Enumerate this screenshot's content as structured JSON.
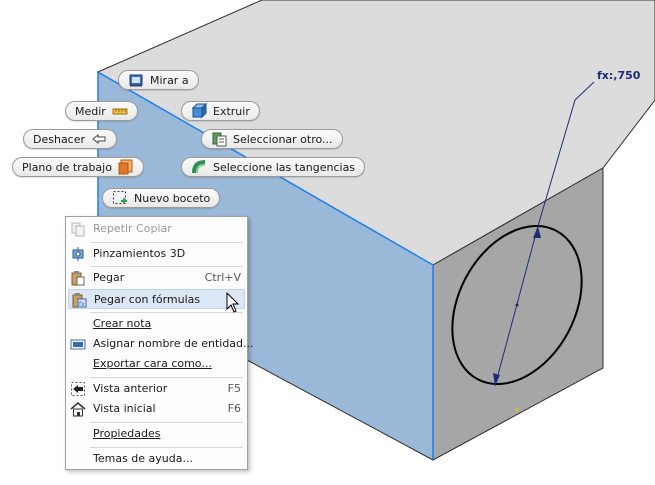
{
  "dimension": {
    "label": "fx:,750"
  },
  "marking_menu": {
    "look_at": "Mirar a",
    "measure": "Medir",
    "extrude": "Extruir",
    "undo": "Deshacer",
    "select_other": "Seleccionar otro...",
    "work_plane": "Plano de trabajo",
    "select_tangents": "Seleccione las tangencias",
    "new_sketch": "Nuevo boceto"
  },
  "context_menu": {
    "repeat_copy": "Repetir Copiar",
    "pinch_3d": "Pinzamientos 3D",
    "paste": "Pegar",
    "paste_shortcut": "Ctrl+V",
    "paste_formulas": "Pegar con fórmulas",
    "create_note": "Crear nota",
    "assign_entity_name": "Asignar nombre de entidad...",
    "export_face": "Exportar cara como...",
    "previous_view": "Vista anterior",
    "previous_view_shortcut": "F5",
    "home_view": "Vista inicial",
    "home_view_shortcut": "F6",
    "properties": "Propiedades",
    "help_topics": "Temas de ayuda..."
  },
  "colors": {
    "top_face": "#dcdcdc",
    "front_face": "#9ab8d8",
    "side_face": "#a6a6a6",
    "edge": "#303030",
    "highlight_edge": "#1f7ff0",
    "dimension": "#1e2c7a"
  }
}
